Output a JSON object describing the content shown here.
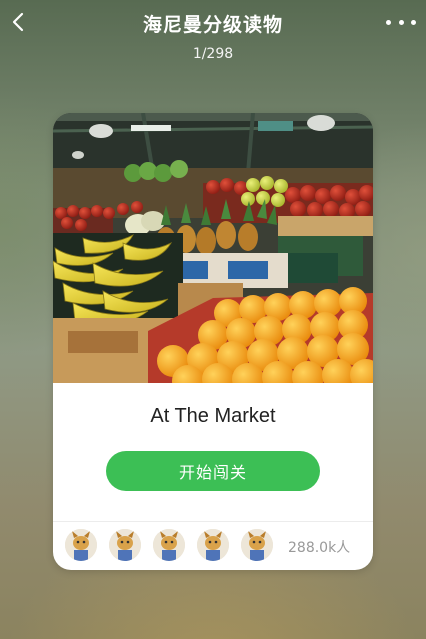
{
  "header": {
    "title": "海尼曼分级读物",
    "page_counter": "1/298",
    "back_icon": "chevron-left-icon",
    "more_icon": "more-dots-icon"
  },
  "book": {
    "title": "At The Market",
    "start_label": "开始闯关",
    "reader_count": "288.0k人",
    "avatar_count": 5
  },
  "colors": {
    "accent": "#3cbf55",
    "card": "#ffffff"
  }
}
